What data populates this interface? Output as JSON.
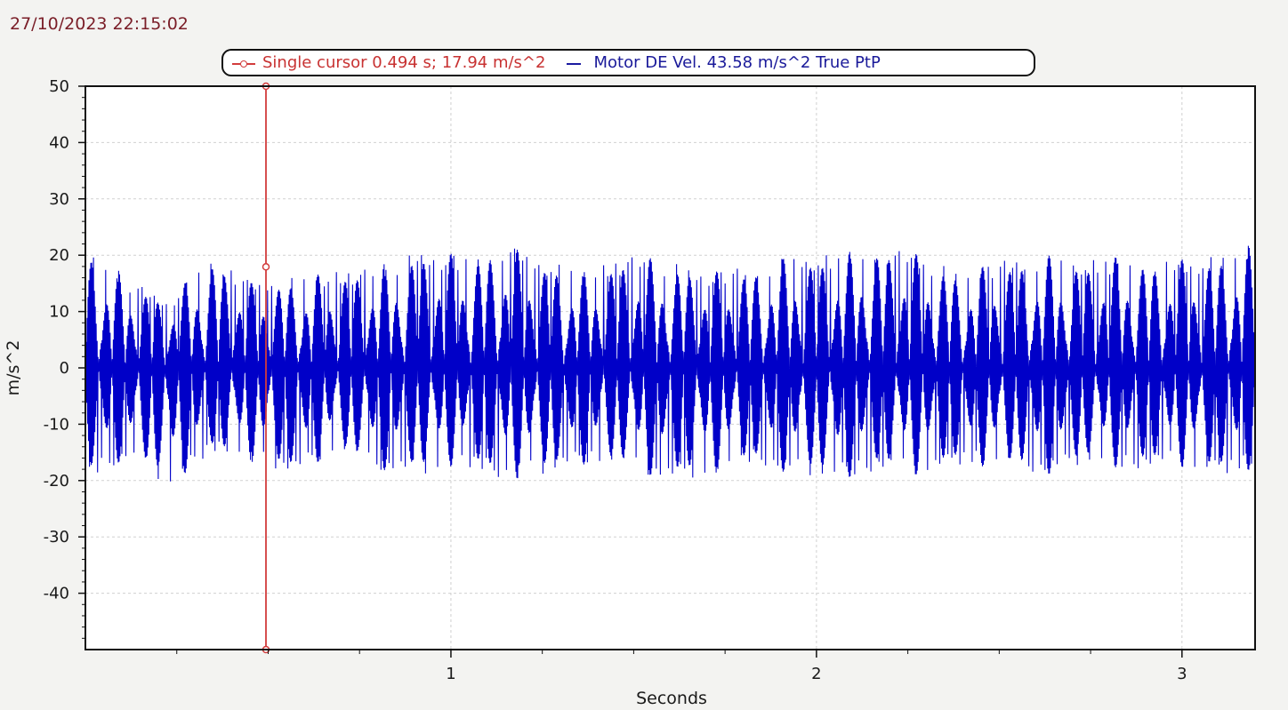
{
  "timestamp": "27/10/2023 22:15:02",
  "legend": {
    "cursor_text": "Single cursor 0.494 s; 17.94 m/s^2",
    "series_text": "Motor DE Vel. 43.58 m/s^2 True PtP"
  },
  "colors": {
    "series": "#0000c8",
    "cursor": "#d23c3c",
    "grid": "#d0d0d0",
    "axis": "#111111",
    "plot_bg": "#ffffff"
  },
  "chart_data": {
    "type": "line",
    "xlabel": "Seconds",
    "ylabel": "m/s^2",
    "xlim": [
      0,
      3.2
    ],
    "ylim": [
      -50,
      50
    ],
    "x_ticks": [
      1,
      2,
      3
    ],
    "x_tick_labels": [
      "1",
      "2",
      "3"
    ],
    "y_ticks": [
      50,
      40,
      30,
      20,
      10,
      0,
      -10,
      -20,
      -30,
      -40
    ],
    "y_tick_labels": [
      "50",
      "40",
      "30",
      "20",
      "10",
      "0",
      "-10",
      "-20",
      "-30",
      "-40"
    ],
    "grid": true,
    "cursor": {
      "x": 0.494,
      "y": 17.94
    },
    "series": [
      {
        "name": "Motor DE Vel.",
        "true_ptp": 43.58,
        "envelope_max": [
          22,
          16,
          12,
          20,
          15,
          16,
          17,
          18,
          21,
          20,
          22,
          19,
          17,
          20,
          19,
          17,
          18,
          20,
          20,
          22,
          20,
          17,
          19,
          20,
          19,
          20,
          19,
          20,
          22
        ],
        "envelope_min": [
          -20,
          -16,
          -21,
          -15,
          -17,
          -19,
          -15,
          -18,
          -19,
          -17,
          -20,
          -19,
          -17,
          -18,
          -20,
          -19,
          -17,
          -19,
          -20,
          -18,
          -19,
          -17,
          -18,
          -19,
          -17,
          -18,
          -17,
          -19,
          -18
        ]
      }
    ]
  }
}
